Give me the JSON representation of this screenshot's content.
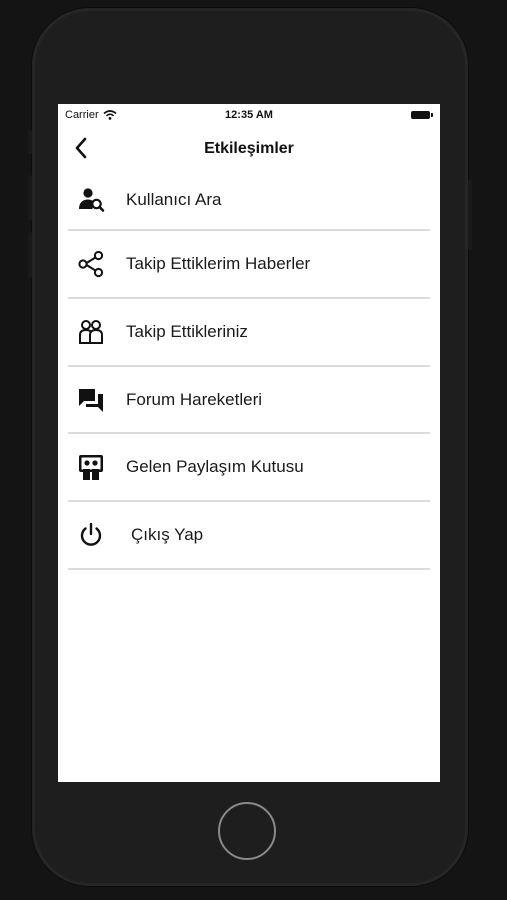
{
  "status_bar": {
    "carrier": "Carrier",
    "time": "12:35 AM"
  },
  "nav": {
    "title": "Etkileşimler"
  },
  "menu": {
    "items": [
      {
        "label": "Kullanıcı Ara",
        "icon": "user-search-icon"
      },
      {
        "label": "Takip Ettiklerim Haberler",
        "icon": "share-icon"
      },
      {
        "label": "Takip Ettikleriniz",
        "icon": "followers-icon"
      },
      {
        "label": "Forum Hareketleri",
        "icon": "forum-icon"
      },
      {
        "label": "Gelen Paylaşım Kutusu",
        "icon": "inbox-share-icon"
      },
      {
        "label": "Çıkış Yap",
        "icon": "power-icon"
      }
    ]
  }
}
